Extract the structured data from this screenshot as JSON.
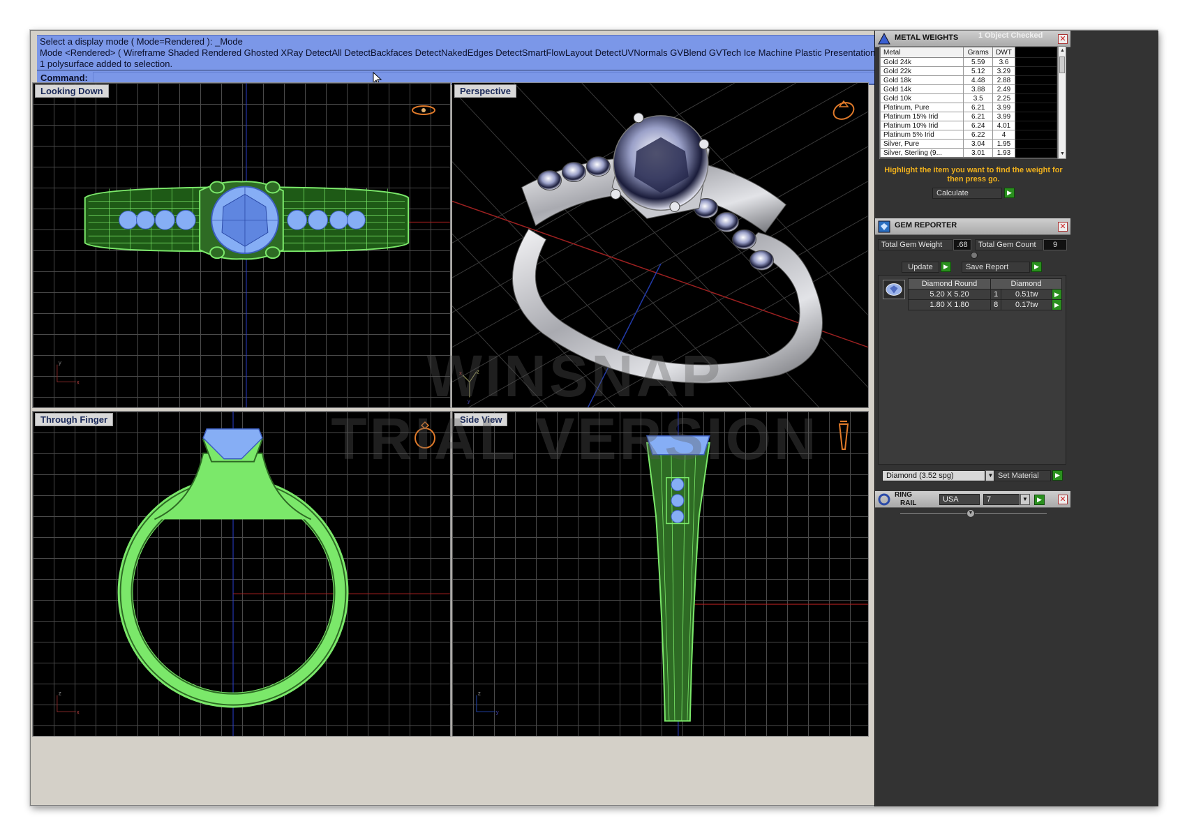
{
  "command": {
    "history": [
      "Select a display mode ( Mode=Rendered ): _Mode",
      "Mode <Rendered> ( Wireframe  Shaded  Rendered  Ghosted  XRay  DetectAll  DetectBackfaces  DetectNakedEdges  DetectSmartFlowLayout  DetectUVNormals  GVBlend  GVTech  Ice  Machine  Plastic  Presentation  S",
      "1 polysurface added to selection."
    ],
    "label": "Command:",
    "value": ""
  },
  "viewports": {
    "top": "Looking Down",
    "perspective": "Perspective",
    "front": "Through Finger",
    "side": "Side View"
  },
  "axes": {
    "top": {
      "v": "y",
      "h": "x"
    },
    "perspective": {
      "v": "z",
      "h": "x",
      "d": "y"
    },
    "front": {
      "v": "z",
      "h": "x"
    },
    "side": {
      "v": "z",
      "h": "y"
    }
  },
  "watermark": {
    "line1": "WINSNAP",
    "line2": "TRIAL VERSION"
  },
  "metal_weights": {
    "title": "METAL WEIGHTS",
    "subtitle": "1 Object Checked",
    "columns": [
      "Metal",
      "Grams",
      "DWT"
    ],
    "rows": [
      [
        "Gold 24k",
        "5.59",
        "3.6"
      ],
      [
        "Gold 22k",
        "5.12",
        "3.29"
      ],
      [
        "Gold 18k",
        "4.48",
        "2.88"
      ],
      [
        "Gold 14k",
        "3.88",
        "2.49"
      ],
      [
        "Gold 10k",
        "3.5",
        "2.25"
      ],
      [
        "Platinum, Pure",
        "6.21",
        "3.99"
      ],
      [
        "Platinum 15% Irid",
        "6.21",
        "3.99"
      ],
      [
        "Platinum 10% Irid",
        "6.24",
        "4.01"
      ],
      [
        "Platinum 5% Irid",
        "6.22",
        "4"
      ],
      [
        "Silver, Pure",
        "3.04",
        "1.95"
      ],
      [
        "Silver, Sterling (9...",
        "3.01",
        "1.93"
      ]
    ],
    "hint": "Highlight the item you want to find the weight for then press go.",
    "calculate": "Calculate"
  },
  "gem_reporter": {
    "title": "GEM REPORTER",
    "total_weight_label": "Total Gem Weight",
    "total_weight": ".68",
    "total_count_label": "Total Gem Count",
    "total_count": "9",
    "update": "Update",
    "save_report": "Save Report",
    "columns": [
      "Diamond Round",
      "Diamond"
    ],
    "rows": [
      {
        "size": "5.20 X 5.20",
        "qty": "1",
        "tw": "0.51tw"
      },
      {
        "size": "1.80 X 1.80",
        "qty": "8",
        "tw": "0.17tw"
      }
    ],
    "material": "Diamond    (3.52 spg)",
    "set_material": "Set Material"
  },
  "ring_rail": {
    "title_line1": "RING",
    "title_line2": "RAIL",
    "country": "USA",
    "size": "7"
  },
  "colors": {
    "command_bg": "#7b97e8",
    "wire_green": "#7be86a",
    "gem_blue": "#86aef5",
    "hint_orange": "#f2b21c",
    "go_green": "#2a8f1e"
  }
}
